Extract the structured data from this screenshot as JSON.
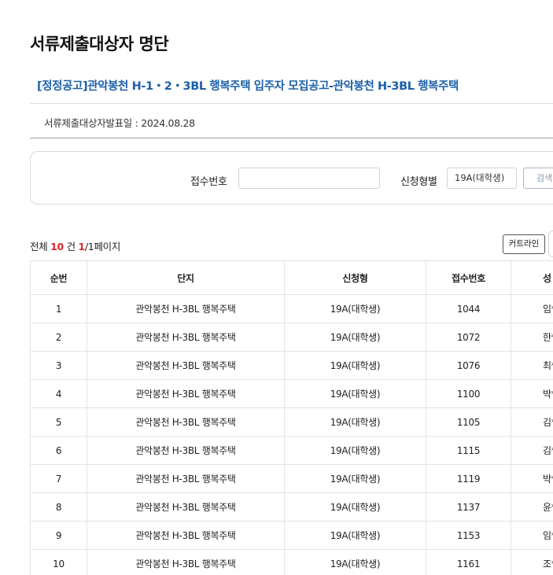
{
  "page": {
    "title": "서류제출대상자 명단",
    "notice_title": "[정정공고]관악봉천 H-1・2・3BL 행복주택 입주자 모집공고-관악봉천 H-3BL 행복주택",
    "announce_date": "서류제출대상자발표일 : 2024.08.28"
  },
  "search": {
    "receipt_label": "접수번호",
    "receipt_value": "",
    "receipt_placeholder": "",
    "type_label": "신청형별",
    "type_selected": "19A(대학생)",
    "search_button": "검색"
  },
  "summary": {
    "prefix": "전체",
    "count": "10",
    "unit": "건",
    "page_current": "1",
    "page_rest": "/1페이지"
  },
  "toolbar": {
    "curtain_label": "커트라인"
  },
  "table": {
    "columns": [
      "순번",
      "단지",
      "신청형",
      "접수번호",
      "성"
    ],
    "rows": [
      [
        "1",
        "관악봉천 H-3BL 행복주택",
        "19A(대학생)",
        "1044",
        "임*"
      ],
      [
        "2",
        "관악봉천 H-3BL 행복주택",
        "19A(대학생)",
        "1072",
        "한*"
      ],
      [
        "3",
        "관악봉천 H-3BL 행복주택",
        "19A(대학생)",
        "1076",
        "최*"
      ],
      [
        "4",
        "관악봉천 H-3BL 행복주택",
        "19A(대학생)",
        "1100",
        "박*"
      ],
      [
        "5",
        "관악봉천 H-3BL 행복주택",
        "19A(대학생)",
        "1105",
        "김*"
      ],
      [
        "6",
        "관악봉천 H-3BL 행복주택",
        "19A(대학생)",
        "1115",
        "김*"
      ],
      [
        "7",
        "관악봉천 H-3BL 행복주택",
        "19A(대학생)",
        "1119",
        "박*"
      ],
      [
        "8",
        "관악봉천 H-3BL 행복주택",
        "19A(대학생)",
        "1137",
        "윤*"
      ],
      [
        "9",
        "관악봉천 H-3BL 행복주택",
        "19A(대학생)",
        "1153",
        "임*"
      ],
      [
        "10",
        "관악봉천 H-3BL 행복주택",
        "19A(대학생)",
        "1161",
        "조*"
      ]
    ]
  },
  "colors": {
    "notice_title": "#1c5fa8",
    "highlight": "#e0262d",
    "table_top_border": "#2e6fb5"
  }
}
